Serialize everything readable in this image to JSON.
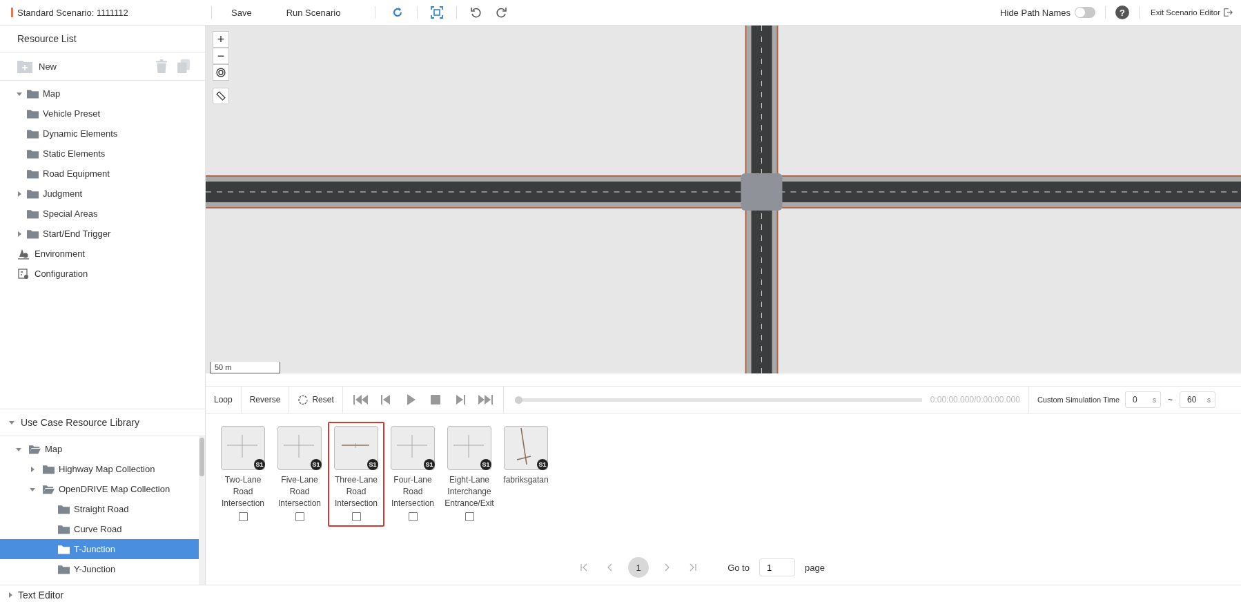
{
  "toolbar": {
    "title": "Standard Scenario: 1111112",
    "buttons": [
      "Save",
      "Run Scenario"
    ],
    "hide_path_names": {
      "label": "Hide Path Names",
      "on": false
    },
    "help": "?",
    "exit": "Exit Scenario Editor"
  },
  "resource_list": {
    "title": "Resource List",
    "new_label": "New",
    "items": [
      {
        "kind": "folder",
        "label": "Map",
        "expanded": true
      },
      {
        "kind": "folder",
        "label": "Vehicle Preset"
      },
      {
        "kind": "folder",
        "label": "Dynamic Elements"
      },
      {
        "kind": "folder",
        "label": "Static Elements"
      },
      {
        "kind": "folder",
        "label": "Road Equipment"
      },
      {
        "kind": "folder",
        "label": "Judgment",
        "expanded": false
      },
      {
        "kind": "folder",
        "label": "Special Areas"
      },
      {
        "kind": "folder",
        "label": "Start/End Trigger",
        "expanded": false
      },
      {
        "kind": "environment",
        "label": "Environment"
      },
      {
        "kind": "configuration",
        "label": "Configuration"
      }
    ]
  },
  "library": {
    "title": "Use Case Resource Library",
    "expanded": true,
    "tree": [
      {
        "label": "Map",
        "expanded": true,
        "selected": false,
        "children": [
          {
            "label": "Highway Map Collection",
            "expanded": false,
            "selected": false
          },
          {
            "label": "OpenDRIVE Map Collection",
            "expanded": true,
            "selected": false,
            "children": [
              {
                "label": "Straight Road",
                "selected": false
              },
              {
                "label": "Curve Road",
                "selected": false
              },
              {
                "label": "T-Junction",
                "selected": true
              },
              {
                "label": "Y-Junction",
                "selected": false
              }
            ]
          }
        ]
      }
    ]
  },
  "text_editor": {
    "label": "Text Editor",
    "expanded": false
  },
  "map": {
    "zoom_in": "+",
    "zoom_out": "−",
    "scale": "50 m"
  },
  "playback": {
    "loop": "Loop",
    "reverse": "Reverse",
    "reset": "Reset",
    "level": 0,
    "time": "0:00:00.000/0:00:00.000",
    "custom_label": "Custom Simulation Time",
    "start": "0",
    "start_unit": "s",
    "separator": "~",
    "end": "60",
    "end_unit": "s"
  },
  "maps": [
    {
      "name": "Two-Lane Road Intersection",
      "badge": "S1",
      "kind": "cross",
      "selected": false,
      "checked": false
    },
    {
      "name": "Five-Lane Road Intersection",
      "badge": "S1",
      "kind": "cross",
      "selected": false,
      "checked": false
    },
    {
      "name": "Three-Lane Road Intersection",
      "badge": "S1",
      "kind": "wide",
      "selected": true,
      "checked": false
    },
    {
      "name": "Four-Lane Road Intersection",
      "badge": "S1",
      "kind": "cross",
      "selected": false,
      "checked": false
    },
    {
      "name": "Eight-Lane Interchange Entrance/Exit",
      "badge": "S1",
      "kind": "cross",
      "selected": false,
      "checked": false
    },
    {
      "name": "fabriksgatan",
      "badge": "S1",
      "kind": "slant",
      "selected": false
    }
  ],
  "pagination": {
    "pages": [
      {
        "label": "1",
        "selected": true
      }
    ],
    "goto_label": "Go to",
    "goto_value": "1",
    "page_label": "page"
  }
}
